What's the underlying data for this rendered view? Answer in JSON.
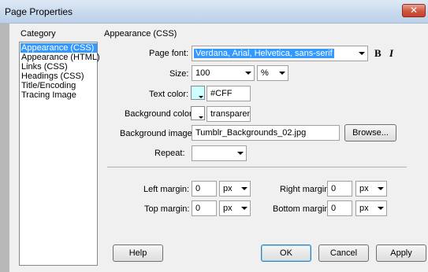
{
  "window": {
    "title": "Page Properties",
    "close_glyph": "✕"
  },
  "category": {
    "label": "Category",
    "items": [
      {
        "label": "Appearance (CSS)",
        "selected": true
      },
      {
        "label": "Appearance (HTML)",
        "selected": false
      },
      {
        "label": "Links (CSS)",
        "selected": false
      },
      {
        "label": "Headings (CSS)",
        "selected": false
      },
      {
        "label": "Title/Encoding",
        "selected": false
      },
      {
        "label": "Tracing Image",
        "selected": false
      }
    ]
  },
  "section": {
    "title": "Appearance (CSS)"
  },
  "form": {
    "page_font_label": "Page font:",
    "page_font_value": "Verdana, Arial, Helvetica, sans-serif",
    "bold_glyph": "B",
    "italic_glyph": "I",
    "size_label": "Size:",
    "size_value": "100",
    "size_unit": "%",
    "text_color_label": "Text color:",
    "text_color_value": "#CFF",
    "text_color_hex": "#CCFFFF",
    "bg_color_label": "Background color:",
    "bg_color_value": "transparent",
    "bg_color_hex": "#ffffff",
    "bg_image_label": "Background image:",
    "bg_image_value": "Tumblr_Backgrounds_02.jpg",
    "browse_label": "Browse...",
    "repeat_label": "Repeat:",
    "repeat_value": ""
  },
  "margins": {
    "left_label": "Left margin:",
    "left_value": "0",
    "left_unit": "px",
    "right_label": "Right margin:",
    "right_value": "0",
    "right_unit": "px",
    "top_label": "Top margin:",
    "top_value": "0",
    "top_unit": "px",
    "bottom_label": "Bottom margin:",
    "bottom_value": "0",
    "bottom_unit": "px"
  },
  "buttons": {
    "help": "Help",
    "ok": "OK",
    "cancel": "Cancel",
    "apply": "Apply"
  },
  "colors": {
    "selection": "#3399ff",
    "dialog_bg": "#f0f0f0"
  }
}
